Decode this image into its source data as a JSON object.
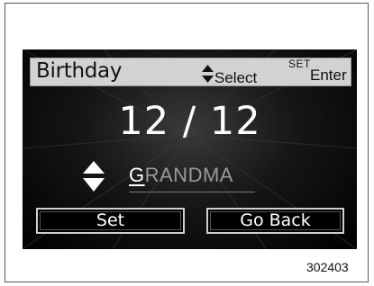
{
  "header": {
    "title": "Birthday",
    "select_label": "Select",
    "enter_key": "SET",
    "enter_label": "Enter"
  },
  "date": {
    "value": "12 / 12"
  },
  "name_field": {
    "cursor_char": "G",
    "rest": "RANDMA"
  },
  "buttons": {
    "set": "Set",
    "go_back": "Go Back"
  },
  "figure_number": "302403",
  "colors": {
    "screen_background": "#000000",
    "header_bar": "#d2d2d2",
    "button_border": "#cfcfcf",
    "inactive_text": "#9a9a9a"
  },
  "icons": [
    "up-down-arrow-icon",
    "up-down-arrow-icon"
  ]
}
